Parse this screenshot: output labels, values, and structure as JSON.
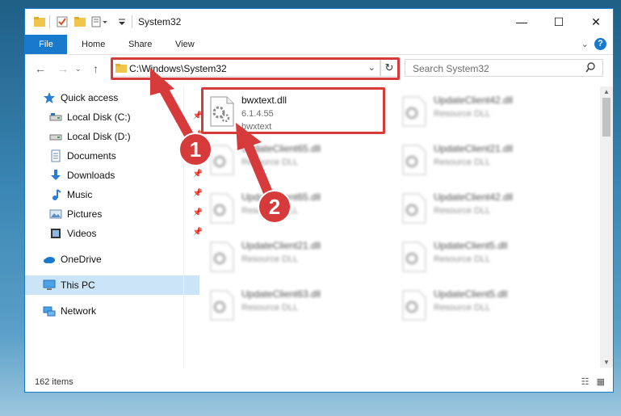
{
  "window": {
    "title": "System32"
  },
  "ribbon": {
    "tabs": [
      "File",
      "Home",
      "Share",
      "View"
    ]
  },
  "address": {
    "path": "C:\\Windows\\System32"
  },
  "search": {
    "placeholder": "Search System32"
  },
  "sidebar": {
    "items": [
      {
        "label": "Quick access",
        "icon": "star-icon"
      },
      {
        "label": "Local Disk (C:)",
        "icon": "drive-icon",
        "pinned": true
      },
      {
        "label": "Local Disk (D:)",
        "icon": "drive-icon",
        "pinned": true
      },
      {
        "label": "Documents",
        "icon": "documents-icon",
        "pinned": true
      },
      {
        "label": "Downloads",
        "icon": "download-icon",
        "pinned": true
      },
      {
        "label": "Music",
        "icon": "music-icon",
        "pinned": true
      },
      {
        "label": "Pictures",
        "icon": "pictures-icon",
        "pinned": true
      },
      {
        "label": "Videos",
        "icon": "videos-icon",
        "pinned": true
      },
      {
        "label": "OneDrive",
        "icon": "cloud-icon"
      },
      {
        "label": "This PC",
        "icon": "computer-icon",
        "selected": true
      },
      {
        "label": "Network",
        "icon": "network-icon"
      }
    ]
  },
  "files": {
    "highlighted": {
      "name": "bwxtext.dll",
      "version": "6.1.4.55",
      "description": "bwxtext"
    },
    "others": [
      {
        "name": "UpdateClient42.dll",
        "description": "Resource DLL"
      },
      {
        "name": "UpdateClient65.dll",
        "description": "Resource DLL"
      },
      {
        "name": "UpdateClient21.dll",
        "description": "Resource DLL"
      },
      {
        "name": "UpdateClient65.dll",
        "description": "Resource DLL"
      },
      {
        "name": "UpdateClient42.dll",
        "description": "Resource DLL"
      },
      {
        "name": "UpdateClient21.dll",
        "description": "Resource DLL"
      },
      {
        "name": "UpdateClient5.dll",
        "description": "Resource DLL"
      },
      {
        "name": "UpdateClient63.dll",
        "description": "Resource DLL"
      },
      {
        "name": "UpdateClient5.dll",
        "description": "Resource DLL"
      }
    ]
  },
  "annotations": {
    "step1": "1",
    "step2": "2",
    "color": "#d63a3a"
  },
  "status": {
    "item_count": "162 items"
  },
  "colors": {
    "accent": "#1979ca",
    "selection": "#cce4f7",
    "highlight": "#d63a3a"
  }
}
